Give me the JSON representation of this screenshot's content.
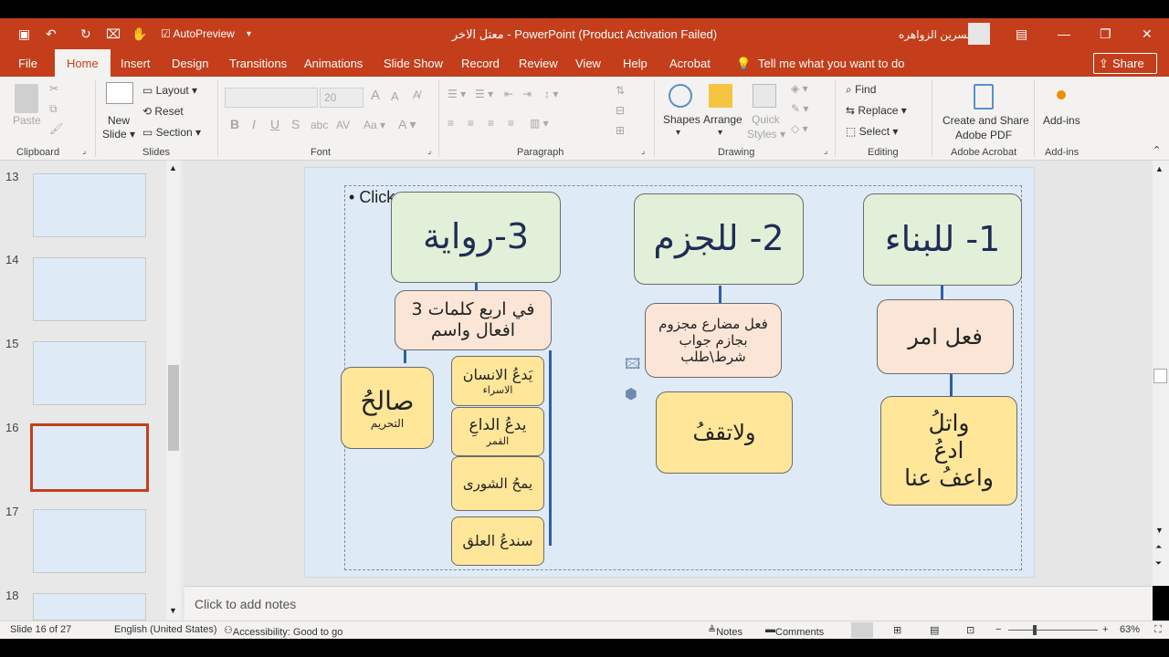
{
  "window": {
    "title": "معتل الاخر  -  PowerPoint (Product Activation Failed)",
    "user": "نسرين الزواهره",
    "autopreview": "AutoPreview"
  },
  "tabs": [
    "File",
    "Home",
    "Insert",
    "Design",
    "Transitions",
    "Animations",
    "Slide Show",
    "Record",
    "Review",
    "View",
    "Help",
    "Acrobat"
  ],
  "tellme": "Tell me what you want to do",
  "share": "Share",
  "ribbon": {
    "clipboard": {
      "paste": "Paste",
      "label": "Clipboard"
    },
    "slides": {
      "new_slide": "New",
      "new_slide2": "Slide",
      "layout": "Layout",
      "reset": "Reset",
      "section": "Section",
      "label": "Slides"
    },
    "font": {
      "size": "20",
      "label": "Font"
    },
    "paragraph": {
      "label": "Paragraph"
    },
    "drawing": {
      "shapes": "Shapes",
      "arrange": "Arrange",
      "quick": "Quick",
      "styles": "Styles",
      "label": "Drawing"
    },
    "editing": {
      "find": "Find",
      "replace": "Replace",
      "select": "Select",
      "label": "Editing"
    },
    "acrobat": {
      "create1": "Create and Share",
      "create2": "Adobe PDF",
      "label": "Adobe Acrobat"
    },
    "addins": {
      "btn": "Add-ins",
      "label": "Add-ins"
    }
  },
  "thumbnails": [
    "13",
    "14",
    "15",
    "16",
    "17",
    "18"
  ],
  "slide": {
    "bullet": "Click",
    "h1": "1- للبناء",
    "h2": "2- للجزم",
    "h3": "3-رواية",
    "b1": "فعل امر",
    "b2": "فعل مضارع مجزوم بجازم جواب شرط\\طلب",
    "b3a": "في اربع كلمات 3",
    "b3b": "افعال واسم",
    "y1a": "واتلُ",
    "y1b": "ادعُ",
    "y1c": "واعفُ عنا",
    "y2": "ولاتقفُ",
    "s1": "يَدعُ الانسان",
    "s1b": "الاسراء",
    "s2": "يدعُ الداعِ",
    "s2b": "القمر",
    "s3": "يمحُ الشورى",
    "s4": "سندعُ العلق",
    "p1": "صالحُ",
    "p1b": "التحريم"
  },
  "notes": "Click to add notes",
  "status": {
    "slide": "Slide 16 of 27",
    "lang": "English (United States)",
    "access": "Accessibility: Good to go",
    "notes": "Notes",
    "comments": "Comments",
    "zoom": "63%"
  }
}
